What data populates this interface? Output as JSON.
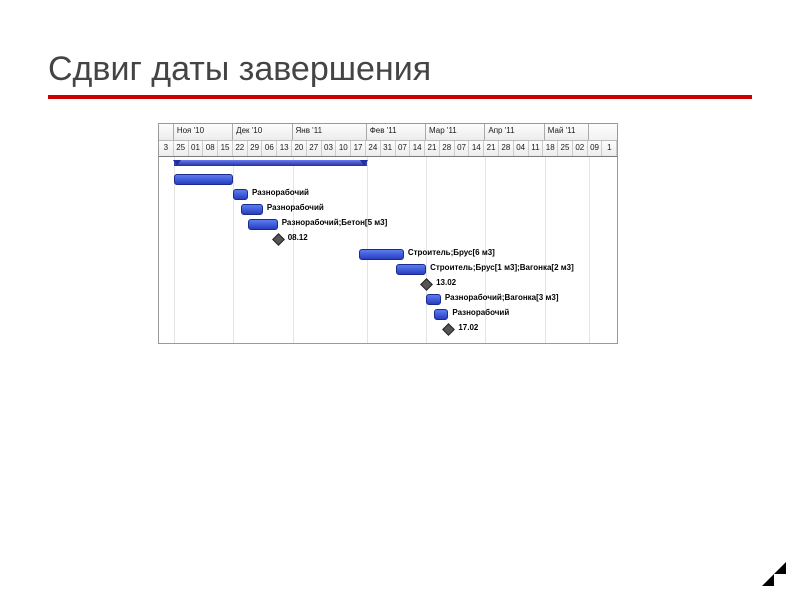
{
  "title": "Сдвиг даты завершения",
  "chart_data": {
    "type": "gantt",
    "timeline": {
      "months": [
        {
          "label": "",
          "span": 1
        },
        {
          "label": "Ноя '10",
          "span": 4
        },
        {
          "label": "Дек '10",
          "span": 4
        },
        {
          "label": "Янв '11",
          "span": 5
        },
        {
          "label": "Фев '11",
          "span": 4
        },
        {
          "label": "Мар '11",
          "span": 4
        },
        {
          "label": "Апр '11",
          "span": 4
        },
        {
          "label": "Май '11",
          "span": 3
        }
      ],
      "days": [
        "3",
        "25",
        "01",
        "08",
        "15",
        "22",
        "29",
        "06",
        "13",
        "20",
        "27",
        "03",
        "10",
        "17",
        "24",
        "31",
        "07",
        "14",
        "21",
        "28",
        "07",
        "14",
        "21",
        "28",
        "04",
        "11",
        "18",
        "25",
        "02",
        "09",
        "1"
      ]
    },
    "tasks": [
      {
        "type": "summary",
        "label": "",
        "start": 1,
        "end": 14
      },
      {
        "type": "bar",
        "label": "",
        "start": 1,
        "end": 5
      },
      {
        "type": "bar",
        "label": "Разнорабочий",
        "start": 5,
        "end": 6
      },
      {
        "type": "bar",
        "label": "Разнорабочий",
        "start": 5.5,
        "end": 7
      },
      {
        "type": "bar",
        "label": "Разнорабочий;Бетон[5 м3]",
        "start": 6,
        "end": 8
      },
      {
        "type": "milestone",
        "label": "08.12",
        "at": 8
      },
      {
        "type": "bar",
        "label": "Строитель;Брус[6 м3]",
        "start": 13.5,
        "end": 16.5
      },
      {
        "type": "bar",
        "label": "Строитель;Брус[1 м3];Вагонка[2 м3]",
        "start": 16,
        "end": 18
      },
      {
        "type": "milestone",
        "label": "13.02",
        "at": 18
      },
      {
        "type": "bar",
        "label": "Разнорабочий;Вагонка[3 м3]",
        "start": 18,
        "end": 19
      },
      {
        "type": "bar",
        "label": "Разнорабочий",
        "start": 18.5,
        "end": 19.5
      },
      {
        "type": "milestone",
        "label": "17.02",
        "at": 19.5
      }
    ]
  }
}
